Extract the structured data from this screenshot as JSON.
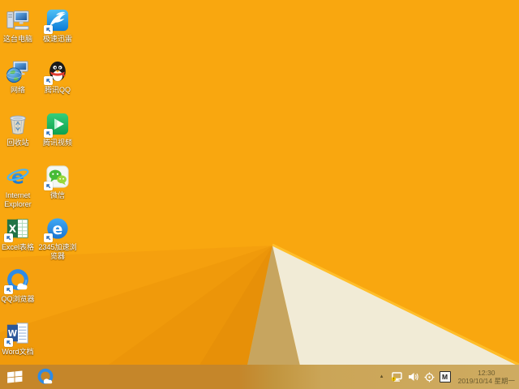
{
  "desktop": {
    "icons": [
      {
        "name": "this-pc",
        "label": "这台电脑",
        "shortcut": false
      },
      {
        "name": "xunlei-speed",
        "label": "极速迅雷",
        "shortcut": true
      },
      {
        "name": "network",
        "label": "网络",
        "shortcut": false
      },
      {
        "name": "tencent-qq",
        "label": "腾讯QQ",
        "shortcut": true
      },
      {
        "name": "recycle-bin",
        "label": "回收站",
        "shortcut": false
      },
      {
        "name": "tencent-video",
        "label": "腾讯视频",
        "shortcut": true
      },
      {
        "name": "internet-explorer",
        "label": "Internet Explorer",
        "shortcut": false
      },
      {
        "name": "wechat",
        "label": "微信",
        "shortcut": true
      },
      {
        "name": "excel",
        "label": "Excel表格",
        "shortcut": true
      },
      {
        "name": "2345-browser",
        "label": "2345加速浏览器",
        "shortcut": true
      },
      {
        "name": "qq-browser",
        "label": "QQ浏览器",
        "shortcut": true
      },
      {
        "name": "word",
        "label": "Word文档",
        "shortcut": true
      }
    ]
  },
  "taskbar": {
    "pinned": [
      "qq-browser"
    ],
    "tray": {
      "chevron": "▲",
      "icons": [
        "network-limited",
        "volume",
        "app-target",
        "ime-m"
      ],
      "ime": "M",
      "time": "12:30",
      "date": "2019/10/14 星期一"
    }
  },
  "colors": {
    "wallpaper_orange": "#F9A70F",
    "wallpaper_cream": "#F1EBD6",
    "wallpaper_tan": "#C7A55F",
    "fold_highlight": "#FFBE2A",
    "taskbar_left": "#C5862A",
    "taskbar_right": "#CEAB61",
    "label_text": "#FFFFFF",
    "clock_text": "#6B5C30"
  }
}
